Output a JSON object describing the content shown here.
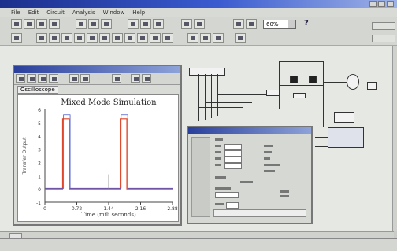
{
  "menu": [
    "File",
    "Edit",
    "Circuit",
    "Analysis",
    "Window",
    "Help"
  ],
  "toolbar": {
    "zoom_value": "60%",
    "help_glyph": "?"
  },
  "scope": {
    "tab_label": "Oscilloscope",
    "chart_data": {
      "type": "line",
      "title": "Mixed Mode Simulation",
      "xlabel": "Time (mili seconds)",
      "ylabel": "Transfer Output",
      "x_ticks": [
        "0",
        "0.72",
        "1.44",
        "2.16",
        "2.88"
      ],
      "y_ticks": [
        "6",
        "5",
        "4",
        "3",
        "2",
        "1",
        "0",
        "-1"
      ],
      "xlim": [
        0,
        2.88
      ],
      "ylim": [
        -1,
        6
      ],
      "series": [
        {
          "color": "#e0462a",
          "x": [
            0,
            0.4,
            0.4,
            0.55,
            0.55,
            1.7,
            1.7,
            1.85,
            1.85,
            2.88
          ],
          "y": [
            0,
            0,
            5.3,
            5.3,
            0,
            0,
            5.3,
            5.3,
            0,
            0
          ]
        },
        {
          "color": "#4a5ad0",
          "x": [
            0,
            0.42,
            0.42,
            0.57,
            0.57,
            1.72,
            1.72,
            1.87,
            1.87,
            2.88
          ],
          "y": [
            0.05,
            0.05,
            5.6,
            5.6,
            0.05,
            0.05,
            5.6,
            5.6,
            0.05,
            0.05
          ]
        }
      ]
    }
  },
  "colors": {
    "trace_red": "#e0462a",
    "trace_blue": "#4a5ad0",
    "title_bar": "#1c2f8c"
  }
}
